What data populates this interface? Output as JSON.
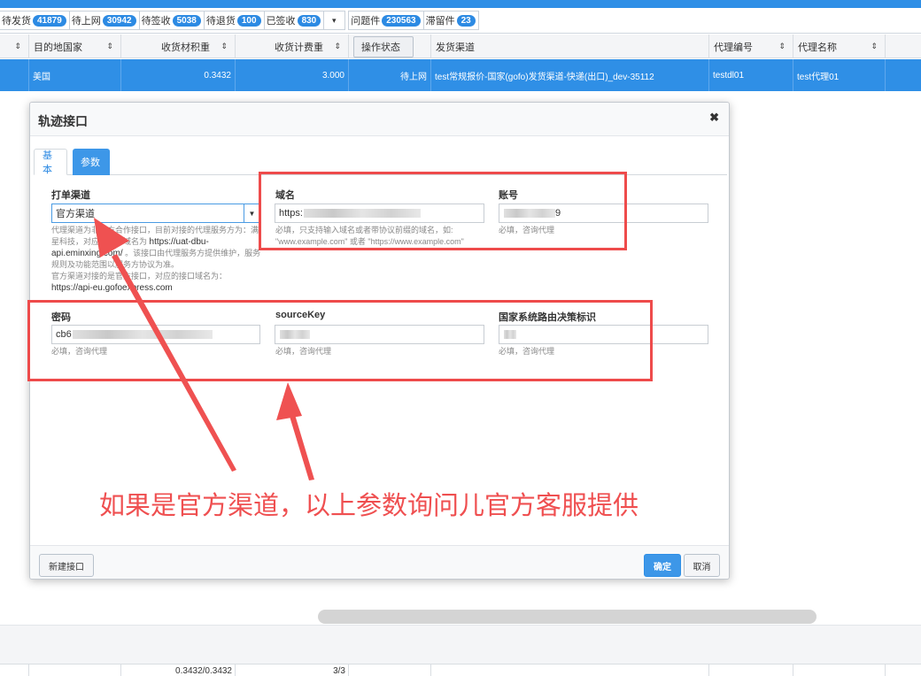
{
  "status_tabs": [
    {
      "label": "待发货",
      "count": "41879"
    },
    {
      "label": "待上网",
      "count": "30942"
    },
    {
      "label": "待签收",
      "count": "5038"
    },
    {
      "label": "待退货",
      "count": "100"
    },
    {
      "label": "已签收",
      "count": "830"
    },
    {
      "label": "问题件",
      "count": "230563"
    },
    {
      "label": "滞留件",
      "count": "23"
    }
  ],
  "status_dropdown_icon": "▾",
  "table": {
    "headers": {
      "sort": "⇕",
      "dest_country": "目的地国家",
      "volume_weight": "收货材积重",
      "billing_weight": "收货计费重",
      "op_status": "操作状态",
      "channel": "发货渠道",
      "agent_code": "代理编号",
      "agent_name": "代理名称"
    },
    "selected_row": {
      "dest_country": "美国",
      "volume_weight": "0.3432",
      "billing_weight": "3.000",
      "op_status": "待上网",
      "channel": "test常规报价-国家(gofo)发货渠道-快递(出口)_dev-35112",
      "agent_code": "testdl01",
      "agent_name": "test代理01"
    },
    "summary": {
      "volume_weight": "0.3432/0.3432",
      "billing_weight": "3/3"
    }
  },
  "modal": {
    "title": "轨迹接口",
    "close_icon": "✖",
    "tabs": [
      "基本",
      "参数"
    ],
    "active_tab": "参数",
    "print_channel": {
      "label": "打单渠道",
      "value": "官方渠道",
      "caret": "▼",
      "hint_1": "代理渠道为非官方合作接口，目前对接的代理服务方为：满星科技，对应的接口域名为",
      "hint_1_url": "https://uat-dbu-api.eminxing.com/",
      "hint_2": "。该接口由代理服务方提供维护，服务规则及功能范围以服务方协议为准。",
      "hint_3": "官方渠道对接的是官方接口，对应的接口域名为：",
      "hint_3_url": "https://api-eu.gofoexpress.com"
    },
    "domain": {
      "label": "域名",
      "value_prefix": "https:",
      "hint": "必填，只支持输入域名或者带协议前缀的域名，如: \"www.example.com\" 或者 \"https://www.example.com\""
    },
    "account": {
      "label": "账号",
      "value_suffix": "9",
      "hint": "必填，咨询代理"
    },
    "password": {
      "label": "密码",
      "value_prefix": "cb6",
      "hint": "必填，咨询代理"
    },
    "source_key": {
      "label": "sourceKey",
      "hint": "必填，咨询代理"
    },
    "route_flag": {
      "label": "国家系统路由决策标识"
    },
    "buttons": {
      "new_interface": "新建接口",
      "confirm": "确定",
      "cancel": "取消"
    }
  },
  "annotation": {
    "text": "如果是官方渠道，以上参数询问儿官方客服提供",
    "color": "#ef4f50"
  }
}
